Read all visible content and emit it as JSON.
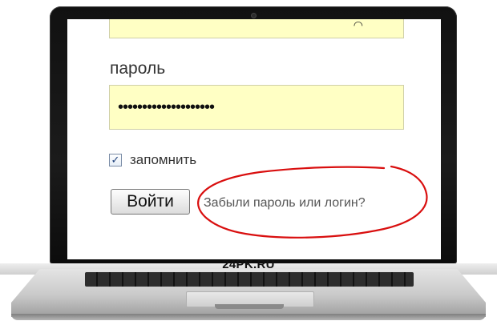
{
  "form": {
    "password_label": "пароль",
    "password_value": "••••••••••••••••••••",
    "remember_label": "запомнить",
    "remember_checked": "✓",
    "login_button": "Войти",
    "forgot_link": "Забыли пароль или логин?"
  },
  "watermark": "24PK.RU",
  "colors": {
    "field_bg": "#ffffc4",
    "annotation_circle": "#d90f0f"
  }
}
